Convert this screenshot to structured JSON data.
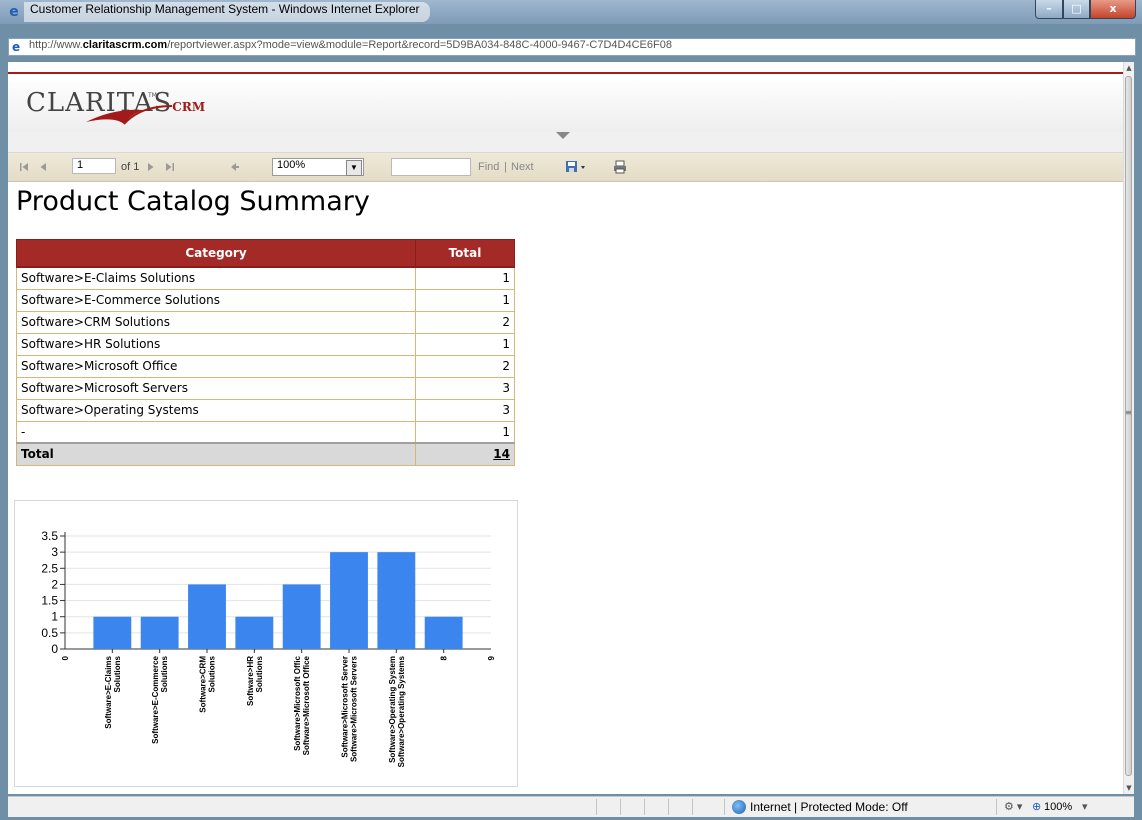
{
  "window": {
    "title": "Customer Relationship Management System - Windows Internet Explorer",
    "address_prefix": "http://www.",
    "address_domain": "claritascrm.com",
    "address_path": "/reportviewer.aspx?mode=view&module=Report&record=5D9BA034-848C-4000-9467-C7D4D4CE6F08",
    "buttons": {
      "minimize": "–",
      "maximize": "□",
      "close": "x"
    }
  },
  "logo": {
    "text": "CLARITAS",
    "tm": "TM",
    "suffix": "CRM"
  },
  "toolbar": {
    "first_icon": "first-page-icon",
    "prev_icon": "previous-page-icon",
    "page_value": "1",
    "of_label": "of 1",
    "next_icon": "next-page-icon",
    "last_icon": "last-page-icon",
    "back_icon": "back-to-parent-icon",
    "zoom_value": "100%",
    "find_label": "Find",
    "separator": "|",
    "next_label": "Next",
    "export_icon": "save-export-icon",
    "print_icon": "printer-icon"
  },
  "report": {
    "title": "Product Catalog Summary",
    "columns": [
      "Category",
      "Total"
    ],
    "rows": [
      {
        "category": "Software>E-Claims Solutions",
        "total": "1"
      },
      {
        "category": "Software>E-Commerce Solutions",
        "total": "1"
      },
      {
        "category": "Software>CRM Solutions",
        "total": "2"
      },
      {
        "category": "Software>HR Solutions",
        "total": "1"
      },
      {
        "category": "Software>Microsoft Office",
        "total": "2"
      },
      {
        "category": "Software>Microsoft Servers",
        "total": "3"
      },
      {
        "category": "Software>Operating Systems",
        "total": "3"
      },
      {
        "category": "-",
        "total": "1"
      }
    ],
    "total_label": "Total",
    "total_value": "14"
  },
  "chart_data": {
    "type": "bar",
    "categories": [
      "Software>E-Claims Solutions",
      "Software>E-Commerce Solutions",
      "Software>CRM Solutions",
      "Software>HR Solutions",
      "Software>Microsoft Office",
      "Software>Microsoft Servers",
      "Software>Operating Systems",
      "8"
    ],
    "values": [
      1,
      1,
      2,
      1,
      2,
      3,
      3,
      1
    ],
    "x_edge_labels": [
      "0",
      "9"
    ],
    "yticks": [
      "0",
      "0.5",
      "1",
      "1.5",
      "2",
      "2.5",
      "3",
      "3.5"
    ],
    "ylim": [
      0,
      3.5
    ],
    "grid": true,
    "bar_color": "#3a86ee"
  },
  "statusbar": {
    "zone": "Internet | Protected Mode: Off",
    "zoom": "100%",
    "zoom_icon": "zoom-icon",
    "security_icon": "security-settings-icon"
  },
  "colors": {
    "header_red": "#a32a26",
    "grid_border": "#d9b57a",
    "toolbar_bg": "#e8e2cf"
  }
}
